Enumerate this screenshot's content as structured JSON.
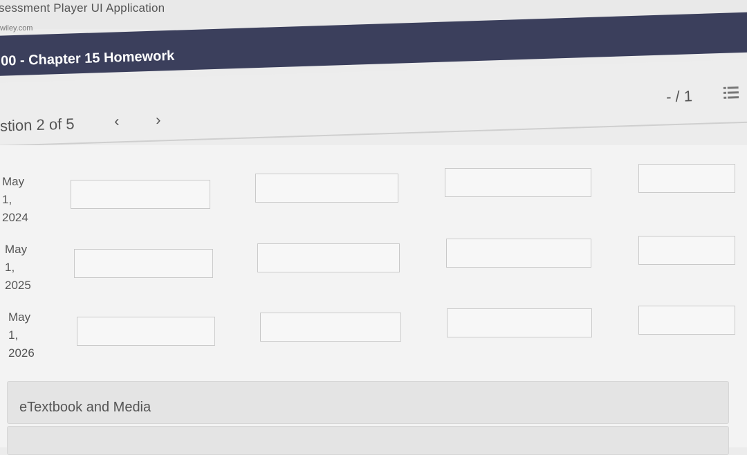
{
  "window": {
    "app_title": "sessment Player UI Application",
    "url": "wiley.com"
  },
  "header": {
    "assignment_title": "00 - Chapter 15 Homework"
  },
  "nav": {
    "question_counter": "stion 2 of 5",
    "prev_label": "‹",
    "next_label": "›",
    "score": "- / 1"
  },
  "table": {
    "rows": [
      {
        "label_month": "May",
        "label_day": "1,",
        "label_year": "2024",
        "inputs": [
          "",
          "",
          "",
          ""
        ]
      },
      {
        "label_month": "May",
        "label_day": "1,",
        "label_year": "2025",
        "inputs": [
          "",
          "",
          "",
          ""
        ]
      },
      {
        "label_month": "May",
        "label_day": "1,",
        "label_year": "2026",
        "inputs": [
          "",
          "",
          "",
          ""
        ]
      }
    ]
  },
  "sections": {
    "media_label": "eTextbook and Media"
  },
  "icons": {
    "menu": "list-menu-icon",
    "prev": "chevron-left-icon",
    "next": "chevron-right-icon"
  },
  "colors": {
    "title_bar": "#3b3f5c",
    "background": "#ececec"
  }
}
